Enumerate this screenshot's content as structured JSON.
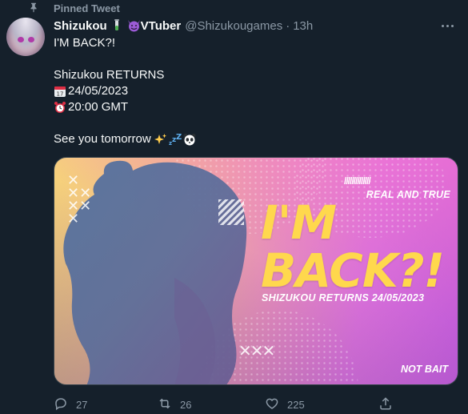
{
  "pinned": {
    "label": "Pinned Tweet",
    "icon": "pin-icon"
  },
  "author": {
    "name": "Shizukou",
    "emoji_1": "test-tube-icon",
    "emoji_2": "smiling-devil-icon",
    "badge_text": "VTuber",
    "handle": "@Shizukougames",
    "separator": "·",
    "time": "13h",
    "avatar_icon": "avatar-image"
  },
  "tweet": {
    "line1": "I'M BACK?!",
    "line2": "Shizukou RETURNS",
    "line3": "24/05/2023",
    "line3_icon": "calendar-icon",
    "line4": "20:00 GMT",
    "line4_icon": "alarm-clock-icon",
    "line5": "See you tomorrow",
    "line5_icons": [
      "sparkles-icon",
      "zzz-icon",
      "panda-icon"
    ]
  },
  "media": {
    "slashes": "//////////////",
    "tag_top": "REAL AND TRUE",
    "headline_1": "I'M",
    "headline_2": "BACK?!",
    "subtitle": "SHIZUKOU RETURNS 24/05/2023",
    "tag_bottom": "NOT BAIT",
    "accent_yellow": "#ffd84d"
  },
  "actions": {
    "replies": "27",
    "retweets": "26",
    "likes": "225"
  },
  "colors": {
    "background": "#15202b",
    "text": "#f7f9f9",
    "muted": "#8b98a5"
  }
}
